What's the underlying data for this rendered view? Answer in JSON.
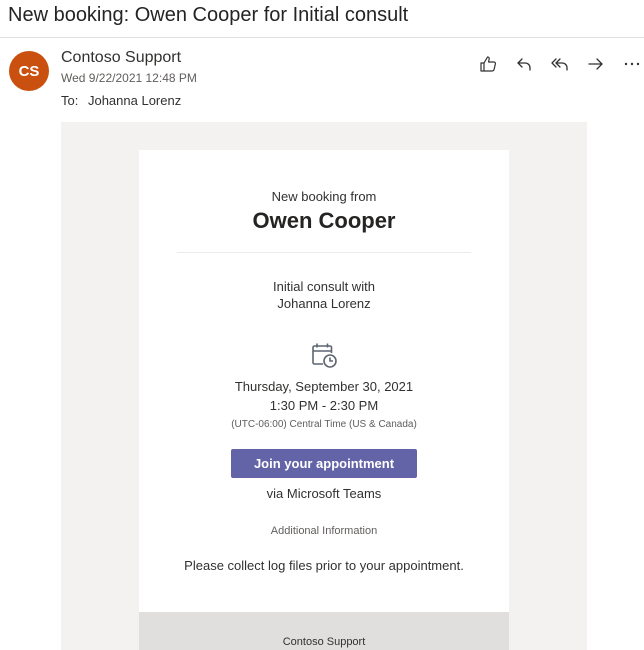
{
  "subject": "New booking: Owen Cooper for Initial consult",
  "sender": {
    "initials": "CS",
    "name": "Contoso Support",
    "date": "Wed 9/22/2021 12:48 PM",
    "avatar_color": "#ca5010"
  },
  "recipients": {
    "label": "To:",
    "value": "Johanna Lorenz"
  },
  "actions": [
    {
      "name": "like-icon"
    },
    {
      "name": "reply-icon"
    },
    {
      "name": "reply-all-icon"
    },
    {
      "name": "forward-icon"
    },
    {
      "name": "more-icon"
    }
  ],
  "booking": {
    "heading": "New booking from",
    "customer": "Owen Cooper",
    "service_line1": "Initial consult with",
    "service_line2": "Johanna Lorenz",
    "date": "Thursday, September 30, 2021",
    "time": "1:30 PM - 2:30 PM",
    "timezone": "(UTC-06:00) Central Time (US & Canada)",
    "join_label": "Join your appointment",
    "join_color": "#6264a7",
    "via": "via Microsoft Teams",
    "additional_heading": "Additional Information",
    "additional_note": "Please collect log files prior to your appointment.",
    "footer": "Contoso Support"
  }
}
